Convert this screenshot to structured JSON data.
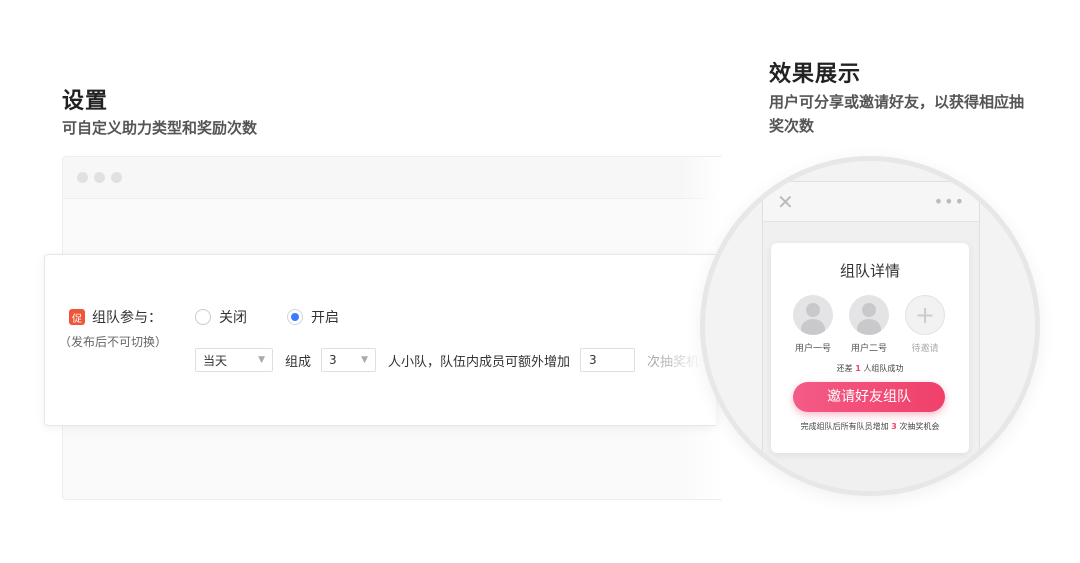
{
  "settings": {
    "title": "设置",
    "subtitle": "可自定义助力类型和奖励次数"
  },
  "form": {
    "badge": "促",
    "label": "组队参与：",
    "note": "（发布后不可切换）",
    "radio_off": "关闭",
    "radio_on": "开启",
    "selected": "开启",
    "period_value": "当天",
    "compose_label": "组成",
    "team_size_value": "3",
    "team_text": "人小队，队伍内成员可额外增加",
    "extra_value": "3",
    "suffix_text": "次抽奖机"
  },
  "preview": {
    "title": "效果展示",
    "subtitle": "用户可分享或邀请好友，以获得相应抽奖次数",
    "team_title": "组队详情",
    "members": [
      {
        "name": "用户一号"
      },
      {
        "name": "用户二号"
      },
      {
        "name": "待邀请"
      }
    ],
    "remain_prefix": "还差",
    "remain_count": "1",
    "remain_suffix": "人组队成功",
    "invite_button": "邀请好友组队",
    "bonus_prefix": "完成组队后所有队员增加",
    "bonus_count": "3",
    "bonus_suffix": "次抽奖机会"
  },
  "icons": {
    "close": "close-icon",
    "more": "more-dots-icon",
    "add": "plus-icon"
  },
  "colors": {
    "accent_blue": "#3a7bff",
    "accent_pink": "#f0406a",
    "badge_red": "#f0553a"
  }
}
